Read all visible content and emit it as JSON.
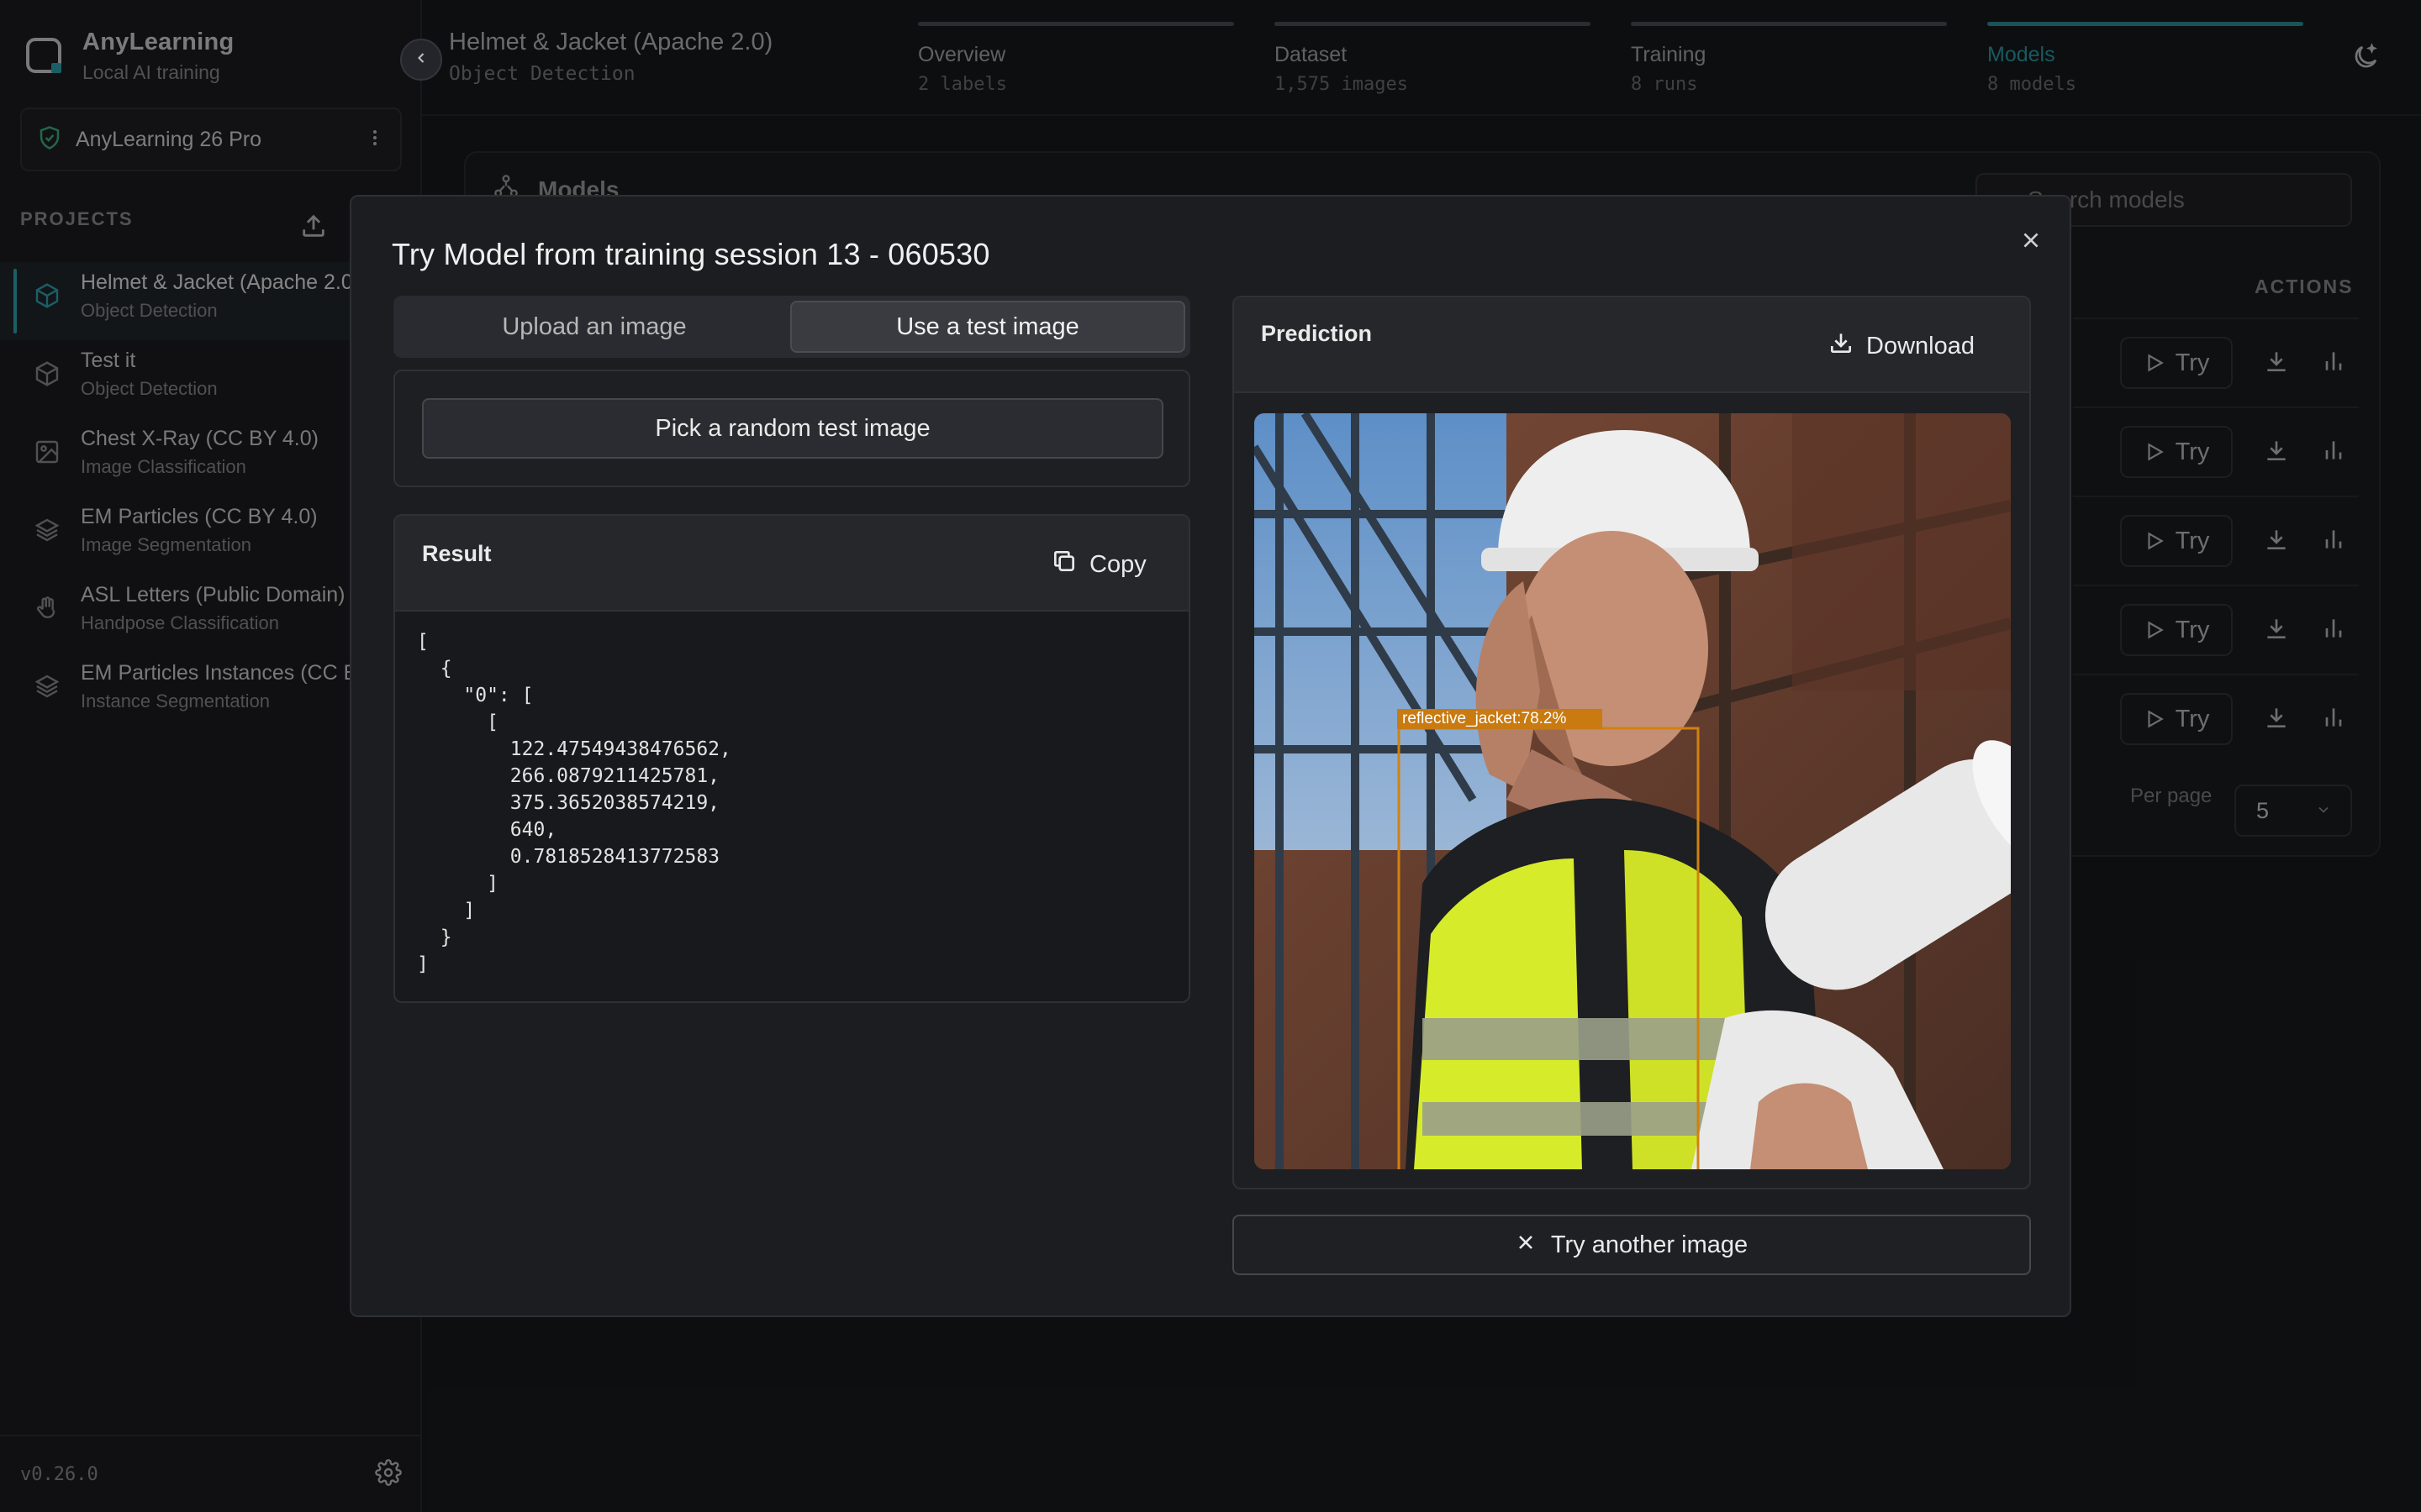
{
  "app": {
    "name": "AnyLearning",
    "tagline": "Local AI training",
    "version": "v0.26.0"
  },
  "license": {
    "label": "AnyLearning 26 Pro"
  },
  "sidebar": {
    "projects_title": "PROJECTS",
    "projects": [
      {
        "title": "Helmet & Jacket (Apache 2.0)",
        "subtitle": "Object Detection",
        "icon": "cube-icon"
      },
      {
        "title": "Test it",
        "subtitle": "Object Detection",
        "icon": "cube-icon"
      },
      {
        "title": "Chest X-Ray (CC BY 4.0)",
        "subtitle": "Image Classification",
        "icon": "image-icon"
      },
      {
        "title": "EM Particles (CC BY 4.0)",
        "subtitle": "Image Segmentation",
        "icon": "layers-icon"
      },
      {
        "title": "ASL Letters (Public Domain)",
        "subtitle": "Handpose Classification",
        "icon": "hand-icon"
      },
      {
        "title": "EM Particles Instances (CC BY 4.0)",
        "subtitle": "Instance Segmentation",
        "icon": "layers-icon"
      }
    ]
  },
  "header": {
    "project_title": "Helmet & Jacket (Apache 2.0)",
    "project_type": "Object Detection",
    "steps": [
      {
        "label": "Overview",
        "count": "2 labels"
      },
      {
        "label": "Dataset",
        "count": "1,575 images"
      },
      {
        "label": "Training",
        "count": "8 runs"
      },
      {
        "label": "Models",
        "count": "8 models"
      }
    ]
  },
  "background": {
    "card_title": "Models",
    "search_placeholder": "Search models",
    "actions_header": "ACTIONS",
    "try_label": "Try",
    "per_page_label": "Per page",
    "per_page_value": "5"
  },
  "modal": {
    "title": "Try Model from training session 13 - 060530",
    "tabs": [
      "Upload an image",
      "Use a test image"
    ],
    "selected_tab": "Use a test image",
    "pick_button": "Pick a random test image",
    "result_title": "Result",
    "copy_label": "Copy",
    "result_json": "[\n  {\n    \"0\": [\n      [\n        122.47549438476562,\n        266.0879211425781,\n        375.3652038574219,\n        640,\n        0.7818528413772583\n      ]\n    ]\n  }\n]",
    "prediction_title": "Prediction",
    "download_label": "Download",
    "detection_label": "reflective_jacket:78.2%",
    "try_another_label": "Try another image"
  },
  "colors": {
    "accent": "#2b8e98",
    "detection_box": "#c97a10",
    "background": "#18191c"
  }
}
